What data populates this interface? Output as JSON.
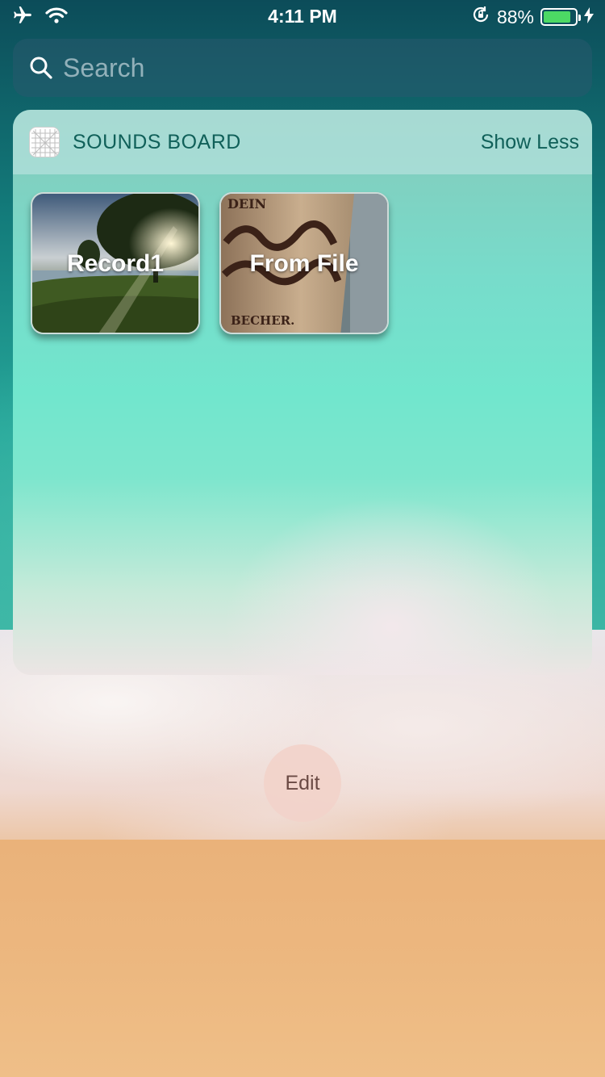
{
  "status_bar": {
    "time": "4:11 PM",
    "battery_percent": "88%",
    "battery_level": 0.88,
    "icons": [
      "airplane-icon",
      "wifi-icon",
      "rotation-lock-icon",
      "battery-icon",
      "charging-icon"
    ]
  },
  "search": {
    "placeholder": "Search"
  },
  "widget": {
    "title": "SOUNDS BOARD",
    "toggle_label": "Show Less",
    "tiles": [
      {
        "label": "Record1",
        "image": "park-sunset-photo"
      },
      {
        "label": "From File",
        "image": "coffee-cup-photo"
      }
    ]
  },
  "edit_label": "Edit",
  "colors": {
    "accent_text": "#106059",
    "battery_green": "#4cd964"
  }
}
